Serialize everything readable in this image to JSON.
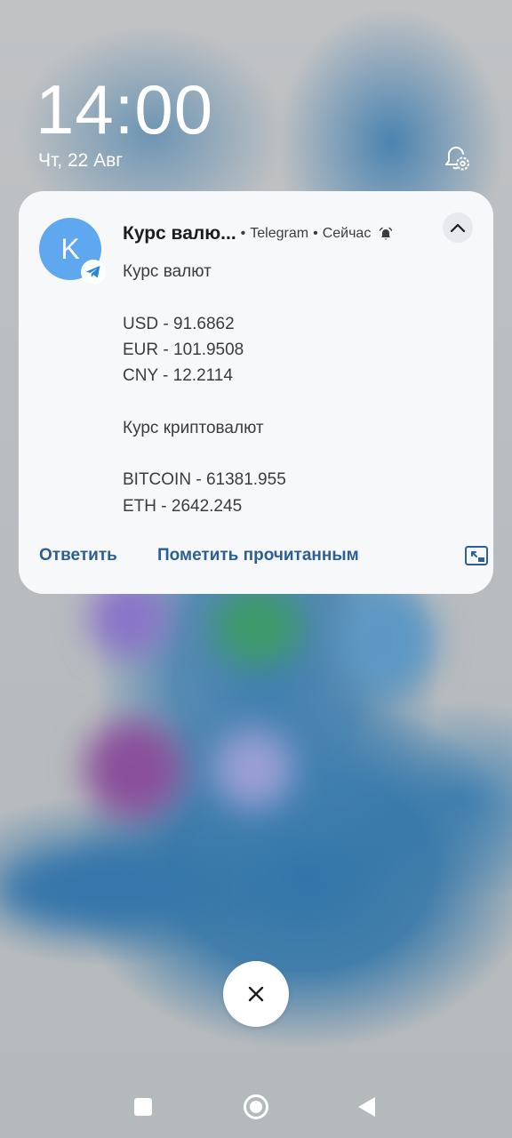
{
  "lockscreen": {
    "time": "14:00",
    "date": "Чт, 22 Авг"
  },
  "notification": {
    "avatar_letter": "K",
    "sender": "Курс валю...",
    "app_name": "Telegram",
    "time": "Сейчас",
    "message_lines": [
      "Курс валют",
      "",
      "USD - 91.6862",
      "EUR - 101.9508",
      "CNY - 12.2114",
      "",
      "Курс криптовалют",
      "",
      "BITCOIN - 61381.955",
      "ETH - 2642.245"
    ],
    "actions": {
      "reply": "Ответить",
      "mark_read": "Пометить прочитанным"
    },
    "icons": {
      "app_badge": "telegram-icon",
      "bell": "bell-icon",
      "expand": "chevron-up-icon",
      "pip": "picture-in-picture-icon"
    },
    "colors": {
      "avatar": "#5fa8f0",
      "action_text": "#2b5f95",
      "card": "#f7f8fa"
    }
  },
  "controls": {
    "dismiss": "close-icon",
    "notification_settings": "bell-settings-icon"
  },
  "navbar": {
    "recents": "square-icon",
    "home": "circle-home-icon",
    "back": "triangle-back-icon"
  }
}
